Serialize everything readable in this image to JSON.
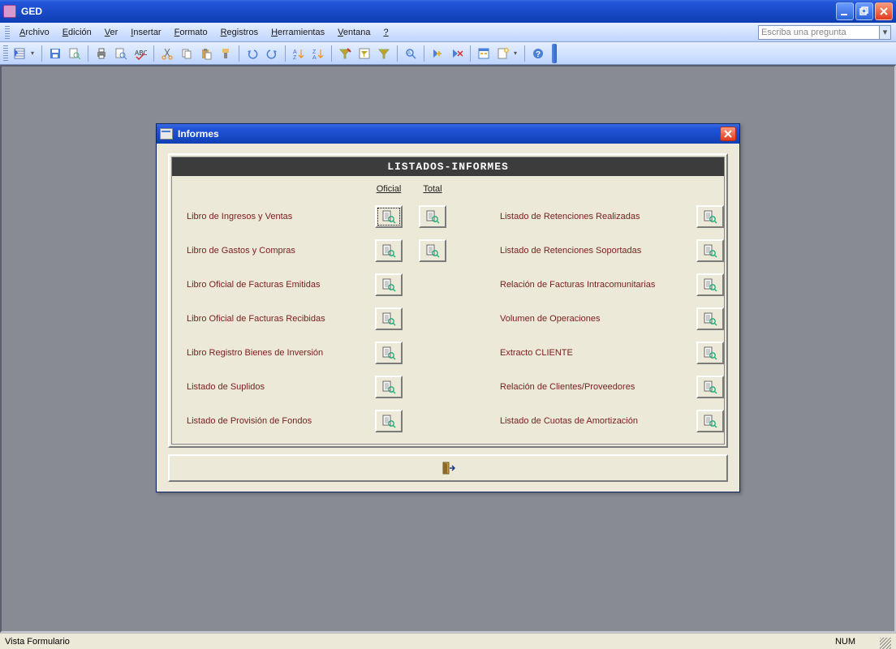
{
  "app": {
    "title": "GED"
  },
  "help_box_placeholder": "Escriba una pregunta",
  "menus": [
    {
      "label": "Archivo",
      "u": 0
    },
    {
      "label": "Edición",
      "u": 0
    },
    {
      "label": "Ver",
      "u": 0
    },
    {
      "label": "Insertar",
      "u": 0
    },
    {
      "label": "Formato",
      "u": 0
    },
    {
      "label": "Registros",
      "u": 0
    },
    {
      "label": "Herramientas",
      "u": 0
    },
    {
      "label": "Ventana",
      "u": 0
    },
    {
      "label": "?",
      "u": 0
    }
  ],
  "dialog": {
    "title": "Informes",
    "panel_header": "LISTADOS-INFORMES",
    "col_headers": {
      "oficial": "Oficial",
      "total": "Total"
    },
    "left_reports": [
      {
        "label": "Libro de Ingresos y Ventas",
        "has_total": true,
        "focused": true
      },
      {
        "label": "Libro de Gastos y Compras",
        "has_total": true
      },
      {
        "label": "Libro Oficial de Facturas Emitidas",
        "has_total": false
      },
      {
        "label": "Libro Oficial de Facturas Recibidas",
        "has_total": false
      },
      {
        "label": "Libro Registro Bienes de Inversión",
        "has_total": false
      },
      {
        "label": "Listado de Suplidos",
        "has_total": false
      },
      {
        "label": "Listado de Provisión de Fondos",
        "has_total": false
      }
    ],
    "right_reports": [
      {
        "label": "Listado de Retenciones Realizadas"
      },
      {
        "label": "Listado de Retenciones Soportadas"
      },
      {
        "label": "Relación de Facturas Intracomunitarias"
      },
      {
        "label": "Volumen de Operaciones"
      },
      {
        "label": "Extracto CLIENTE"
      },
      {
        "label": "Relación de Clientes/Proveedores"
      },
      {
        "label": "Listado de Cuotas de Amortización"
      }
    ]
  },
  "statusbar": {
    "view": "Vista Formulario",
    "num": "NUM"
  }
}
